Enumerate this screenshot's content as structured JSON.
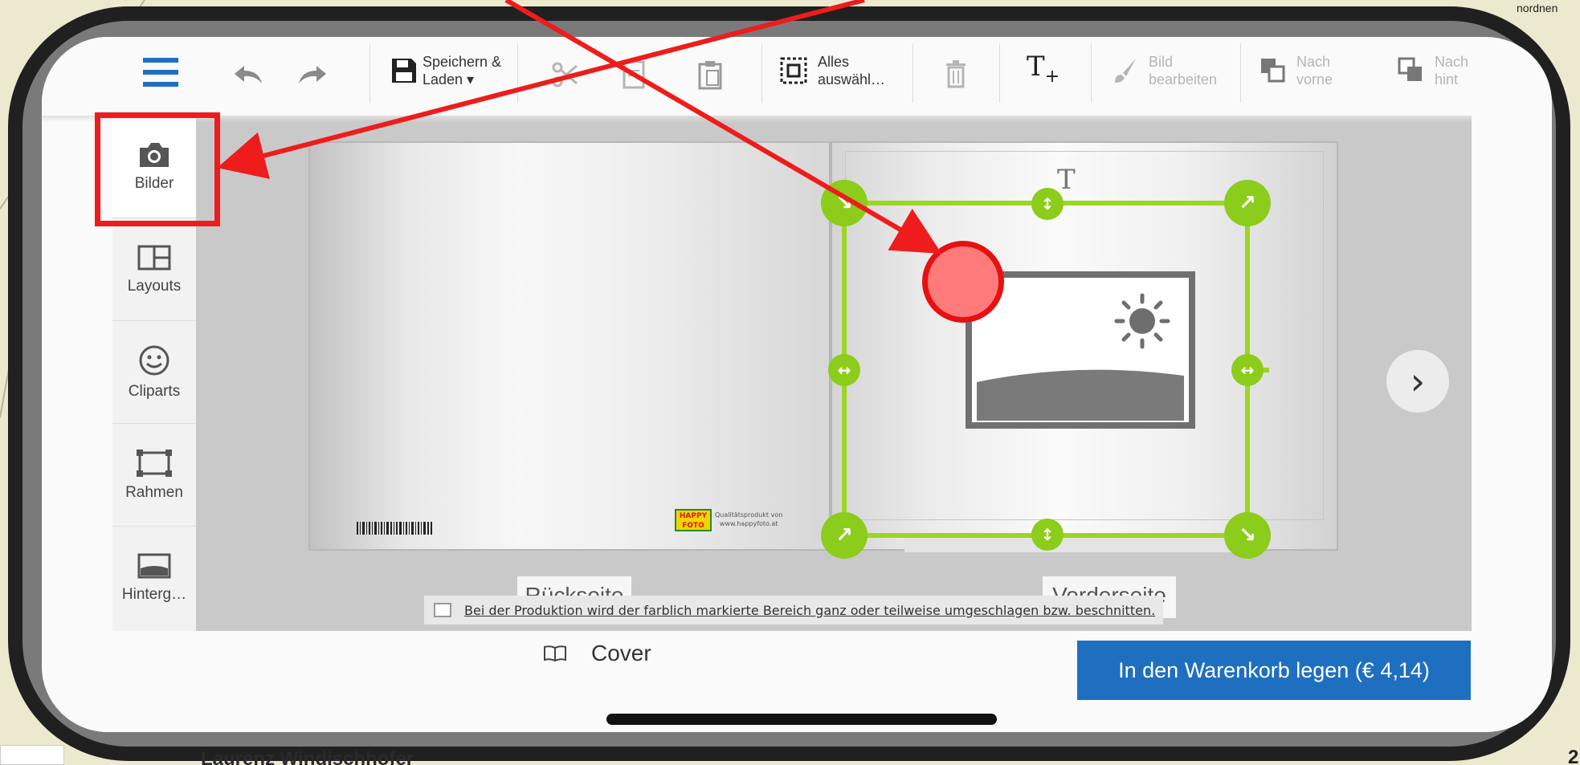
{
  "slide": {
    "author": "Laurenz Windischhofer",
    "corner_text": "nordnen",
    "page_number": "2"
  },
  "toolbar": {
    "save_label_1": "Speichern &",
    "save_label_2": "Laden ▾",
    "select_all_1": "Alles",
    "select_all_2": "auswähl…",
    "edit_image_1": "Bild",
    "edit_image_2": "bearbeiten",
    "bring_front_1": "Nach",
    "bring_front_2": "vorne",
    "send_back_1": "Nach",
    "send_back_2": "hint"
  },
  "sidebar": {
    "items": [
      {
        "label": "Bilder",
        "icon": "camera-icon",
        "active": true
      },
      {
        "label": "Layouts",
        "icon": "layout-icon"
      },
      {
        "label": "Cliparts",
        "icon": "smiley-icon"
      },
      {
        "label": "Rahmen",
        "icon": "frame-icon"
      },
      {
        "label": "Hinterg…",
        "icon": "background-icon"
      }
    ]
  },
  "book": {
    "back_label": "Rückseite",
    "front_label": "Vorderseite",
    "logo_text": "HAPPY FOTO",
    "quality_text_1": "Qualitätsprodukt von",
    "quality_text_2": "www.happyfoto.at",
    "text_tool_glyph": "T"
  },
  "notice": {
    "text": "Bei der Produktion wird der farblich markierte Bereich ganz oder teilweise umgeschlagen bzw. beschnitten."
  },
  "bottom": {
    "cover_label": "Cover",
    "cart_label": "In den Warenkorb legen (€ 4,14)"
  },
  "colors": {
    "highlight": "#ee1c1c",
    "selection": "#8ccc1a",
    "cart": "#1f6fc1"
  }
}
